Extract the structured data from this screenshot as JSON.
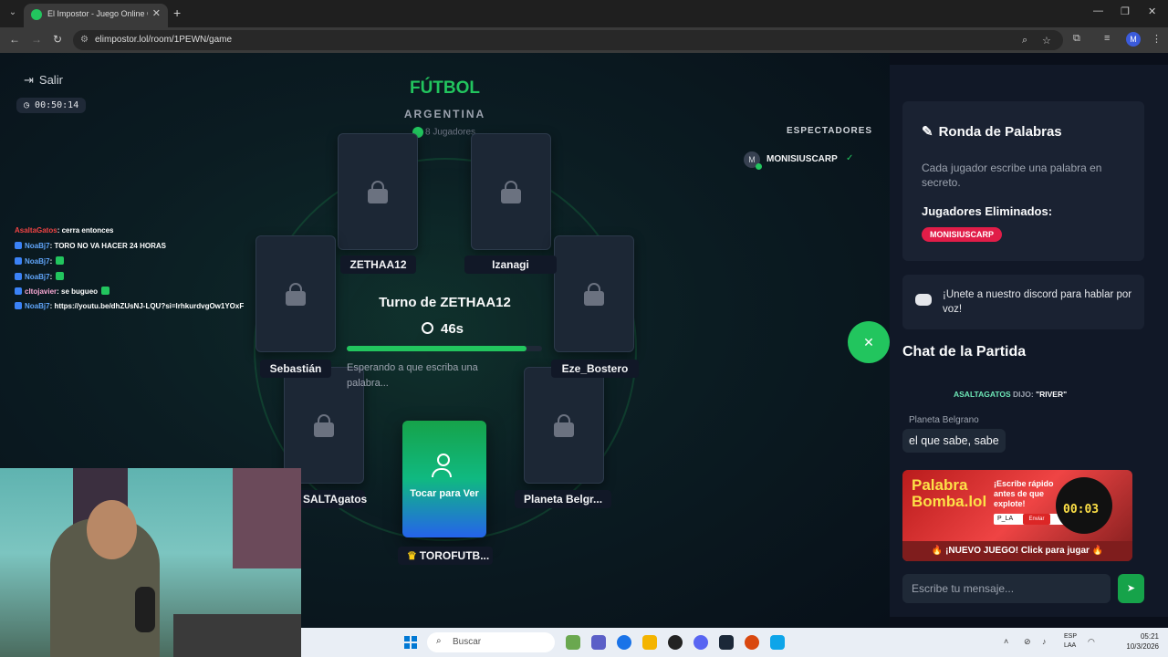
{
  "browser": {
    "tab_title": "El Impostor - Juego Online Gra",
    "tab_close": "✕",
    "new_tab": "+",
    "url": "elimpostor.lol/room/1PEWN/game",
    "profile_initial": "M",
    "win_minimize": "—",
    "win_maximize": "❐",
    "win_close": "✕"
  },
  "game": {
    "exit_label": "Salir",
    "elapsed": "00:50:14",
    "category": "FÚTBOL",
    "subcategory": "ARGENTINA",
    "players_count": "8 Jugadores",
    "turn_title": "Turno de ZETHAA12",
    "turn_seconds": "46s",
    "turn_progress": 0.92,
    "waiting_text": "Esperando a que escriba una palabra...",
    "players": [
      {
        "name": "ZETHAA12"
      },
      {
        "name": "Izanagi"
      },
      {
        "name": "Sebastián"
      },
      {
        "name": "Eze_Bostero"
      },
      {
        "name": "SALTAgatos"
      },
      {
        "name": "Planeta Belgr..."
      }
    ],
    "me": {
      "card_label": "Tocar para Ver",
      "name": "TOROFUTB...",
      "crown": "♛"
    },
    "spectators_title": "ESPECTADORES",
    "spectators": [
      {
        "initial": "M",
        "name": "MONISIUSCARP"
      }
    ],
    "fab_icon": "✕"
  },
  "stream_chat": [
    {
      "user": "AsaltaGatos",
      "text": ": cerra entonces",
      "color": "#ef4444",
      "badge": false
    },
    {
      "user": "NoaBj7",
      "text": ": TORO NO VA HACER 24 HORAS",
      "color": "#60a5fa",
      "badge": true
    },
    {
      "user": "NoaBj7",
      "text": ":",
      "color": "#60a5fa",
      "badge": true,
      "emote": true
    },
    {
      "user": "NoaBj7",
      "text": ":",
      "color": "#60a5fa",
      "badge": true,
      "emote": true
    },
    {
      "user": "cltojavier",
      "text": ": se bugueo",
      "color": "#f9a8d4",
      "badge": true,
      "emote": true
    },
    {
      "user": "NoaBj7",
      "text": ": https://youtu.be/dhZUsNJ-LQU?si=lrhkurdvgOw1YOxF",
      "color": "#60a5fa",
      "badge": true
    }
  ],
  "panel": {
    "rules_title": "Ronda de Palabras",
    "rules_desc": "Cada jugador escribe una palabra en secreto.",
    "eliminated_label": "Jugadores Eliminados:",
    "eliminated": [
      "MONISIUSCARP"
    ],
    "discord_text": "¡Unete a nuestro discord para hablar por voz!",
    "chat_title": "Chat de la Partida",
    "system_msg": {
      "who": "ASALTAGATOS",
      "said": "DIJO:",
      "word": "\"RIVER\""
    },
    "message": {
      "author": "Planeta Belgrano",
      "text": "el que sabe, sabe"
    },
    "ad": {
      "logo_line1": "Palabra",
      "logo_line2": "Bomba.lol",
      "slogan": "¡Escribe rápido antes de que explote!",
      "input_text": "P_LA",
      "button": "Enviar",
      "time": "00:03",
      "footer": "🔥 ¡NUEVO JUEGO! Click para jugar 🔥"
    },
    "chat_placeholder": "Escribe tu mensaje...",
    "send_icon": "➤"
  },
  "taskbar": {
    "search": "Buscar",
    "lang1": "ESP",
    "lang2": "LAA",
    "time": "05:21",
    "date": "10/3/2026"
  }
}
